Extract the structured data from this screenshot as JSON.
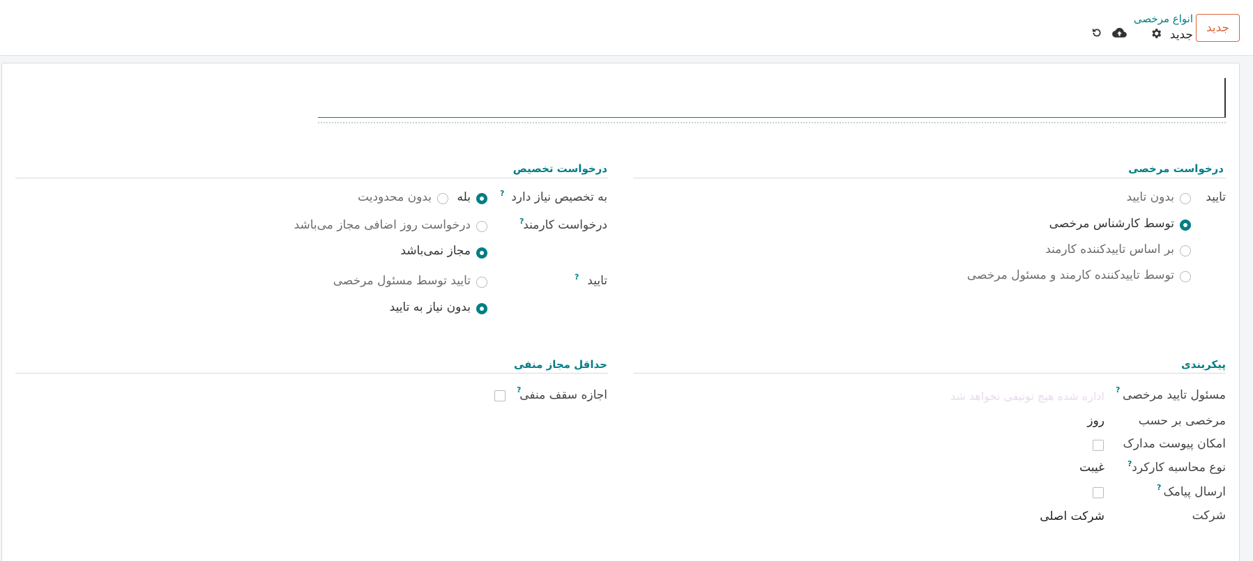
{
  "header": {
    "new_button": "جدید",
    "breadcrumb_parent": "انواع مرخصی",
    "breadcrumb_current": "جدید",
    "icons": [
      "gear-icon",
      "cloud-upload-icon",
      "undo-icon"
    ]
  },
  "form": {
    "name_value": "",
    "leave_request": {
      "title": "درخواست مرخصی",
      "approval_label": "تایید",
      "options": [
        "بدون تایید",
        "توسط کارشناس مرخصی",
        "بر اساس تاییدکننده کارمند",
        "توسط تاییدکننده کارمند و مسئول مرخصی"
      ],
      "selected": 1
    },
    "allocation_request": {
      "title": "درخواست تخصیص",
      "requires_allocation_label": "به تخصیص نیاز دارد",
      "requires_allocation_options": [
        "بله",
        "بدون محدودیت"
      ],
      "requires_allocation_selected": 0,
      "employee_request_label": "درخواست کارمند",
      "employee_request_options": [
        "درخواست روز اضافی مجاز می‌باشد",
        "مجاز نمی‌باشد"
      ],
      "employee_request_selected": 1,
      "approval_label": "تایید",
      "approval_options": [
        "تایید توسط مسئول مرخصی",
        "بدون نیاز به تایید"
      ],
      "approval_selected": 1
    },
    "configuration": {
      "title": "پیکربندی",
      "responsible_label": "مسئول تایید مرخصی",
      "responsible_placeholder": "اداره شده هیچ نوتیفی نخواهد شد",
      "unit_label": "مرخصی بر حسب",
      "unit_value": "روز",
      "attachments_label": "امکان پیوست مدارک",
      "work_entry_label": "نوع محاسبه کارکرد",
      "work_entry_value": "غیبت",
      "send_sms_label": "ارسال پیامک",
      "company_label": "شرکت",
      "company_value": "شرکت اصلی"
    },
    "negative_cap": {
      "title": "حداقل مجاز منفی",
      "allow_label": "اجازه سقف منفی"
    },
    "help_mark": "?"
  },
  "colors": {
    "accent": "#017e84",
    "new_button": "#d9663a"
  }
}
